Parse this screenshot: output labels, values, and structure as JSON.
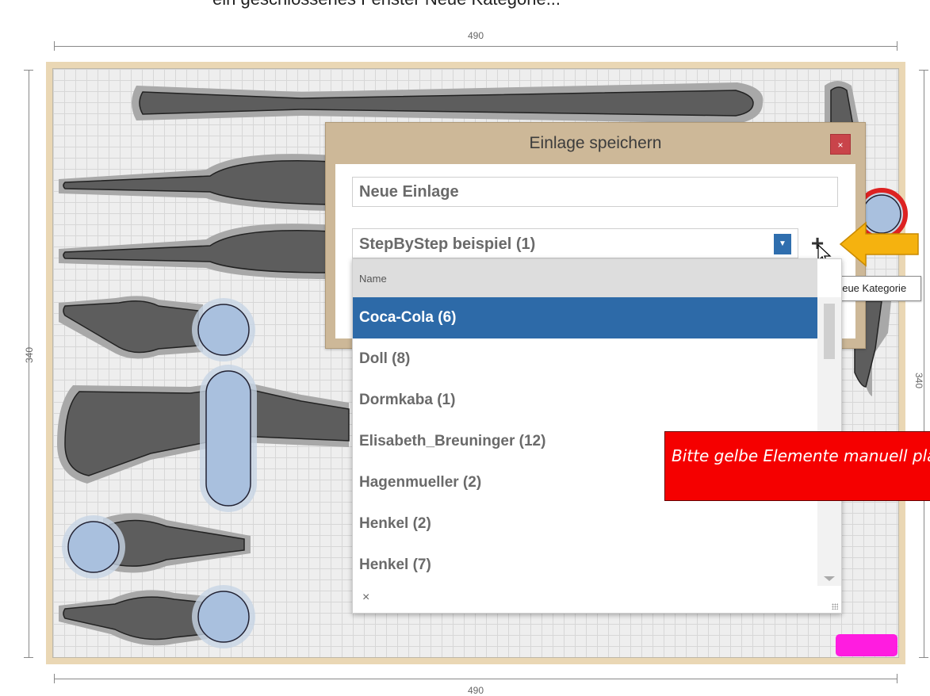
{
  "page": {
    "top_text": "ein geschlossenes Fenster Neue Kategorie..."
  },
  "dimensions": {
    "top": "490",
    "bottom": "490",
    "left": "340",
    "right": "340"
  },
  "dialog": {
    "title": "Einlage speichern",
    "close_label": "×",
    "name_value": "Neue Einlage",
    "category_selected": "StepByStep beispiel (1)",
    "add_button_label": "+",
    "add_tooltip": "Neue Kategorie"
  },
  "dropdown": {
    "column_header": "Name",
    "items": [
      "Coca-Cola  (6)",
      "Doll (8)",
      "Dormkaba (1)",
      "Elisabeth_Breuninger (12)",
      "Hagenmueller (2)",
      "Henkel (2)",
      "Henkel (7)"
    ],
    "selected_index": 0,
    "clear_label": "×"
  },
  "warning": {
    "text": "Bitte gelbe Elemente manuell platzieren"
  },
  "colors": {
    "tray_border": "#ead7b4",
    "selection": "#2d6aa8",
    "warning": "#f50000",
    "arrow": "#f5b20f",
    "marker": "#ff1ce0"
  }
}
